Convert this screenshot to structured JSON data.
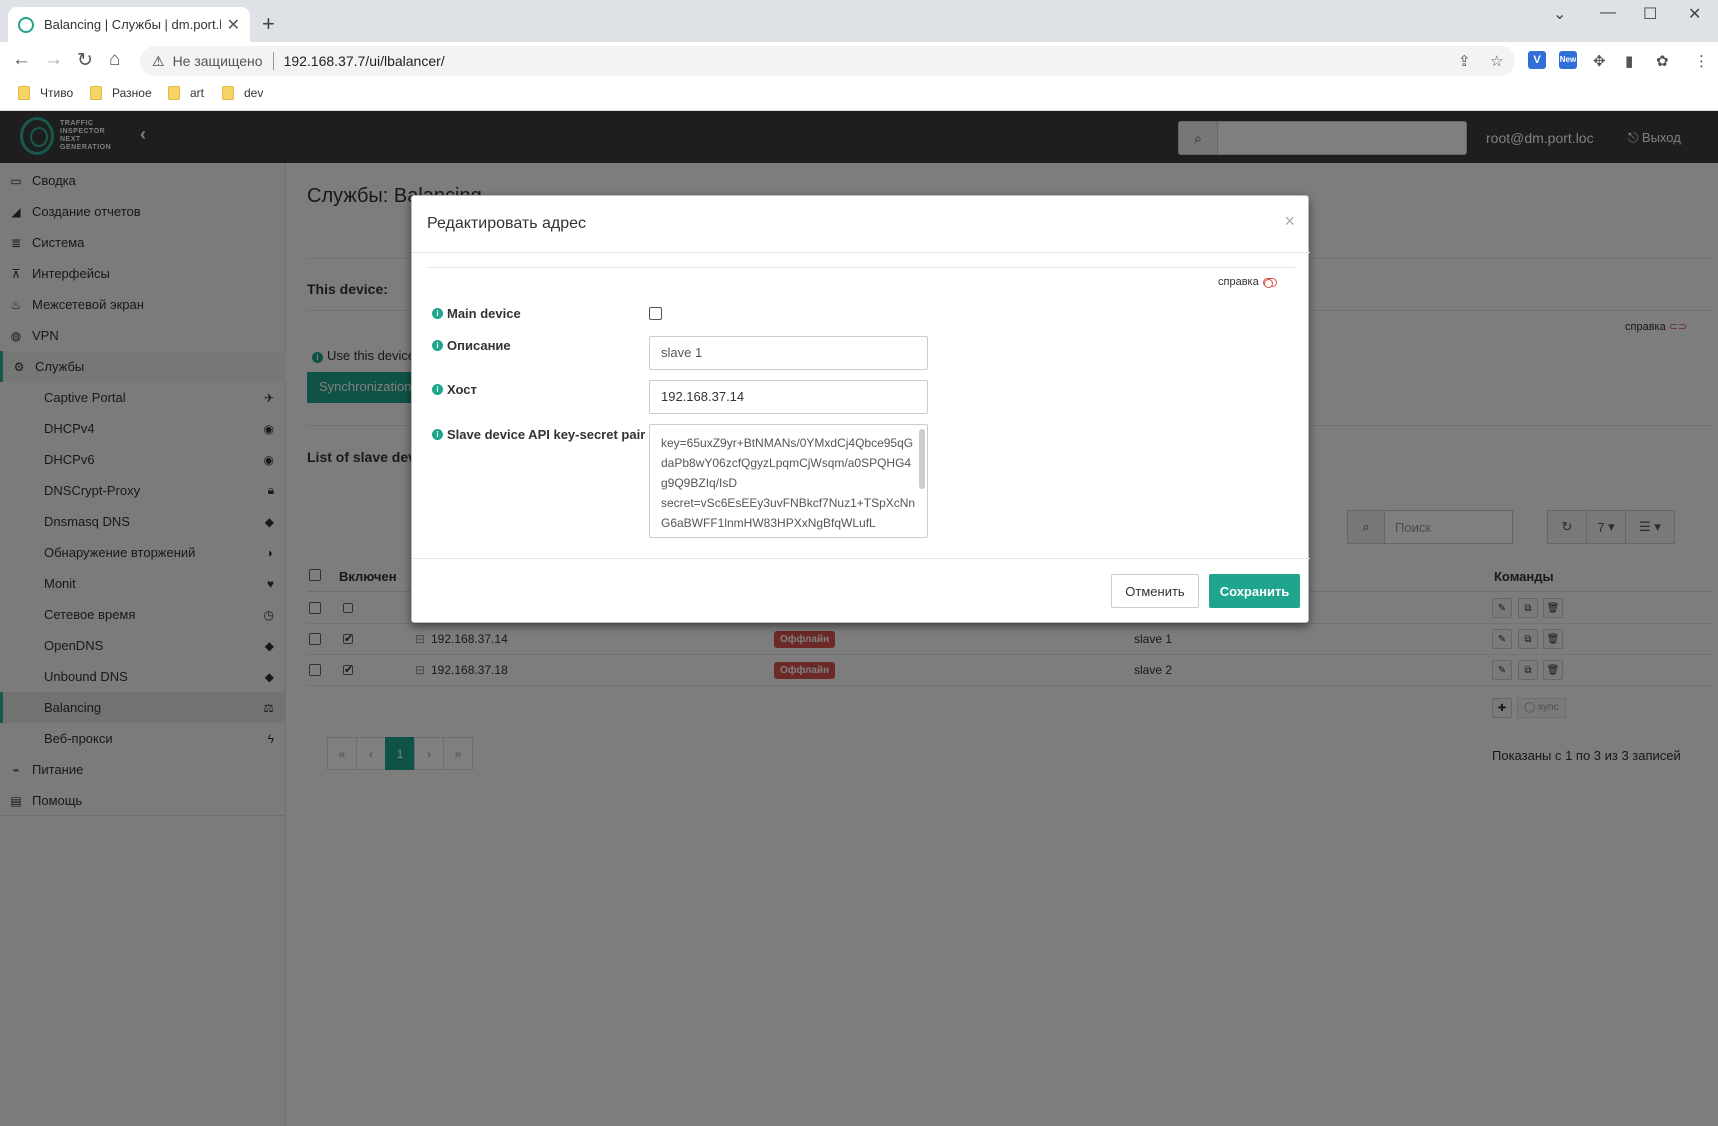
{
  "browser": {
    "tab_title": "Balancing | Службы | dm.port.loc",
    "insecure_label": "Не защищено",
    "url": "192.168.37.7/ui/lbalancer/",
    "bookmarks": [
      "Чтиво",
      "Разное",
      "art",
      "dev"
    ],
    "ext_new_label": "New",
    "ext_v_label": "V"
  },
  "header": {
    "logo_lines": [
      "TRAFFIC",
      "INSPECTOR",
      "NEXT",
      "GENERATION"
    ],
    "user": "root@dm.port.loc",
    "logout": "Выход"
  },
  "sidebar": {
    "items": [
      {
        "label": "Сводка",
        "icon": "monitor-icon"
      },
      {
        "label": "Создание отчетов",
        "icon": "area-chart-icon"
      },
      {
        "label": "Система",
        "icon": "server-icon"
      },
      {
        "label": "Интерфейсы",
        "icon": "sitemap-icon"
      },
      {
        "label": "Межсетевой экран",
        "icon": "fire-icon"
      },
      {
        "label": "VPN",
        "icon": "globe-icon"
      },
      {
        "label": "Службы",
        "icon": "gear-icon"
      }
    ],
    "services": [
      {
        "label": "Captive Portal",
        "icon": "paper-plane-icon"
      },
      {
        "label": "DHCPv4",
        "icon": "bullseye-icon"
      },
      {
        "label": "DHCPv6",
        "icon": "bullseye-icon"
      },
      {
        "label": "DNSCrypt-Proxy",
        "icon": "lock-icon"
      },
      {
        "label": "Dnsmasq DNS",
        "icon": "tags-icon"
      },
      {
        "label": "Обнаружение вторжений",
        "icon": "shield-icon"
      },
      {
        "label": "Monit",
        "icon": "heartbeat-icon"
      },
      {
        "label": "Сетевое время",
        "icon": "clock-icon"
      },
      {
        "label": "OpenDNS",
        "icon": "tags-icon"
      },
      {
        "label": "Unbound DNS",
        "icon": "tags-icon"
      },
      {
        "label": "Balancing",
        "icon": "balance-scale-icon"
      },
      {
        "label": "Веб-прокси",
        "icon": "bolt-icon"
      }
    ],
    "bottom": [
      {
        "label": "Питание",
        "icon": "plug-icon"
      },
      {
        "label": "Помощь",
        "icon": "book-icon"
      }
    ]
  },
  "main": {
    "page_title": "Службы: Balancing",
    "this_device": "This device:",
    "help": "справка",
    "use_this_device": "Use this device",
    "sync_button": "Synchronization",
    "list_title": "List of slave devices",
    "search_placeholder": "Поиск",
    "page_size": "7",
    "table": {
      "col_enabled": "Включен",
      "col_commands": "Команды",
      "rows": [
        {
          "host": "",
          "status": "",
          "desc": "",
          "enabled": false
        },
        {
          "host": "192.168.37.14",
          "status": "Оффлайн",
          "desc": "slave 1",
          "enabled": true
        },
        {
          "host": "192.168.37.18",
          "status": "Оффлайн",
          "desc": "slave 2",
          "enabled": true
        }
      ]
    },
    "sync_label": "sync",
    "pager": [
      "«",
      "‹",
      "1",
      "›",
      "»"
    ],
    "showing": "Показаны с 1 по 3 из 3 записей"
  },
  "modal": {
    "title": "Редактировать адрес",
    "help": "справка",
    "main_device_label": "Main device",
    "description_label": "Описание",
    "description_value": "slave 1",
    "host_label": "Хост",
    "host_value": "192.168.37.14",
    "api_label": "Slave device API key-secret pair",
    "api_value": "key=65uxZ9yr+BtNMANs/0YMxdCj4Qbce95qGdaPb8wY06zcfQgyzLpqmCjWsqm/a0SPQHG4g9Q9BZIq/IsD\nsecret=vSc6EsEEy3uvFNBkcf7Nuz1+TSpXcNnG6aBWFF1lnmHW83HPXxNgBfqWLufL",
    "cancel": "Отменить",
    "save": "Сохранить"
  },
  "colors": {
    "accent": "#1fa58d",
    "header_bg": "#3c3c3c",
    "offline": "#d9534f"
  }
}
